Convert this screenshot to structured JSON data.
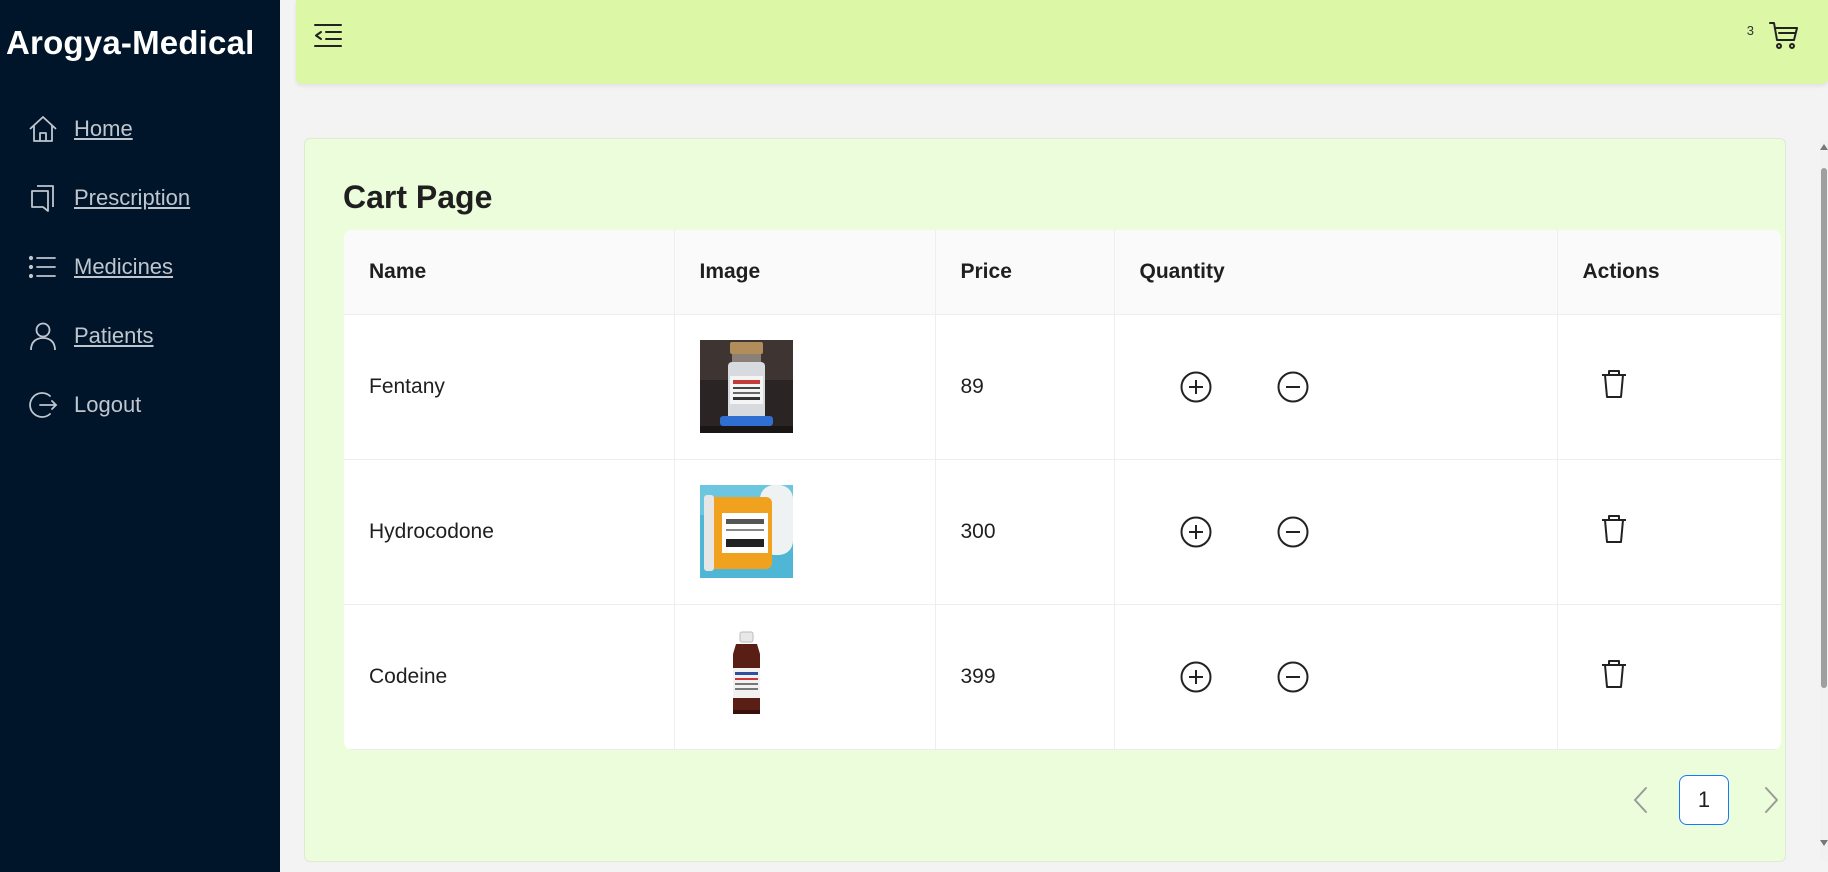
{
  "app": {
    "brand": "Arogya-Medical"
  },
  "sidebar": {
    "items": [
      {
        "label": "Home",
        "icon": "home-icon"
      },
      {
        "label": "Prescription",
        "icon": "prescription-icon"
      },
      {
        "label": "Medicines",
        "icon": "list-icon"
      },
      {
        "label": "Patients",
        "icon": "user-icon"
      },
      {
        "label": "Logout",
        "icon": "logout-icon"
      }
    ]
  },
  "header": {
    "cart_count": "3",
    "menu_icon": "menu-fold-icon",
    "cart_icon": "cart-icon"
  },
  "page": {
    "title": "Cart Page"
  },
  "table": {
    "columns": [
      "Name",
      "Image",
      "Price",
      "Quantity",
      "Actions"
    ],
    "rows": [
      {
        "name": "Fentany",
        "price": "89",
        "image": "vial-image"
      },
      {
        "name": "Hydrocodone",
        "price": "300",
        "image": "pill-bottle-image"
      },
      {
        "name": "Codeine",
        "price": "399",
        "image": "syrup-bottle-image"
      }
    ]
  },
  "pagination": {
    "current": "1"
  },
  "colors": {
    "sidebar": "#001529",
    "header": "#dcf7a5",
    "card": "#ebfddb",
    "accent": "#1677ff"
  }
}
